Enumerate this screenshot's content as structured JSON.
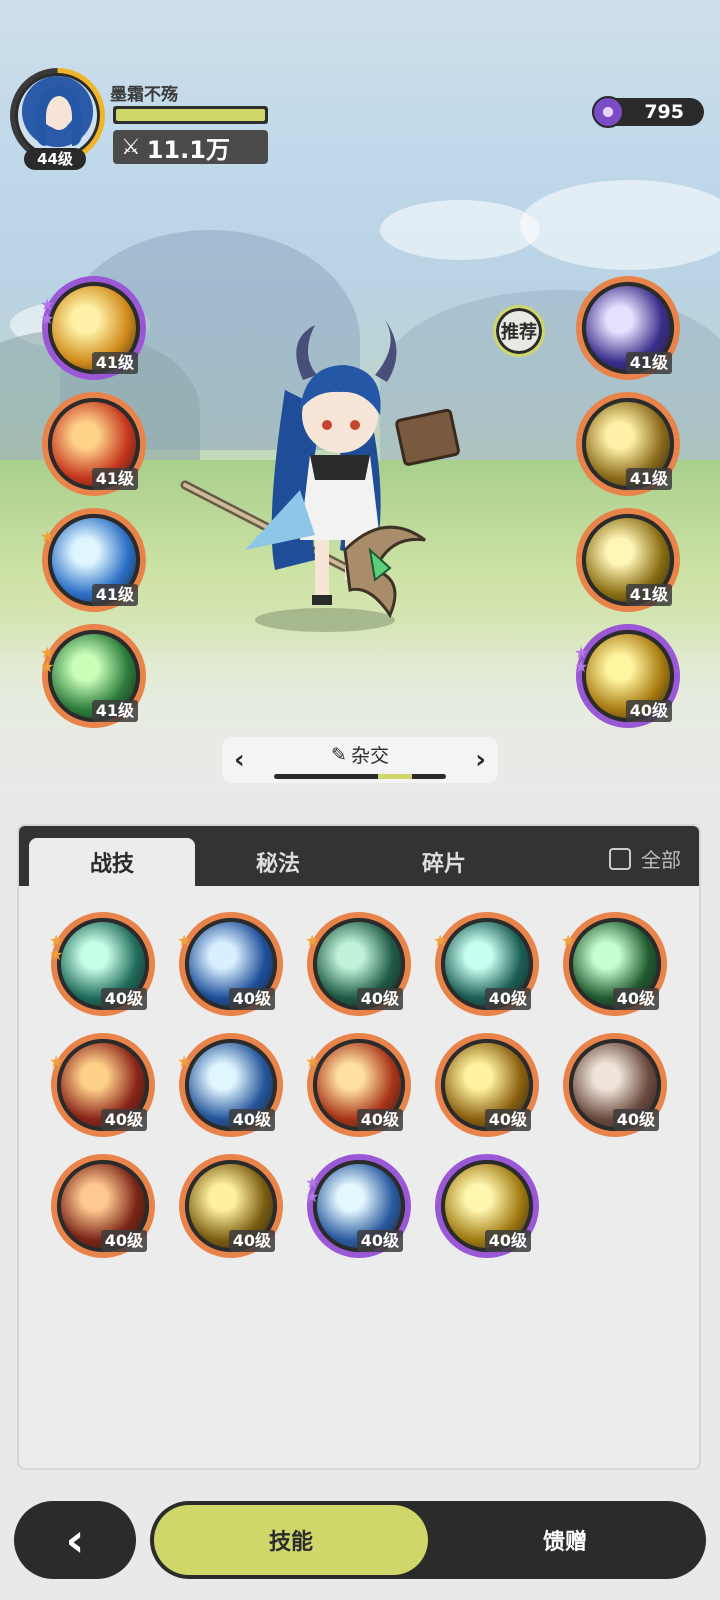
{
  "player": {
    "name": "墨霜不殇",
    "level": "44级",
    "power": "11.1万",
    "exp_fraction": 1.0
  },
  "currency": {
    "amount": "795",
    "icon": "purple-crystal-icon"
  },
  "recommend_label": "推荐",
  "left_skills": [
    {
      "level": "41级",
      "icon": "golden-lightning-icon",
      "frame": "purple",
      "stars": [
        "p",
        "p"
      ],
      "colors": [
        "#fff2a8",
        "#d08a1a"
      ]
    },
    {
      "level": "41级",
      "icon": "fire-burst-icon",
      "frame": "orange",
      "stars": [],
      "colors": [
        "#ffd28a",
        "#c4361d"
      ]
    },
    {
      "level": "41级",
      "icon": "ice-splash-icon",
      "frame": "orange",
      "stars": [
        "o"
      ],
      "colors": [
        "#dff6ff",
        "#2b6fc6"
      ]
    },
    {
      "level": "41级",
      "icon": "green-comet-icon",
      "frame": "orange",
      "stars": [
        "o",
        "o"
      ],
      "colors": [
        "#c9ffb8",
        "#2a7a3a"
      ]
    }
  ],
  "right_skills": [
    {
      "level": "41级",
      "icon": "starry-portal-icon",
      "frame": "orange",
      "stars": [],
      "colors": [
        "#e8e0ff",
        "#3a2f8a"
      ]
    },
    {
      "level": "41级",
      "icon": "golden-arrows-icon",
      "frame": "orange",
      "stars": [],
      "colors": [
        "#fff2a8",
        "#8a6a1a"
      ]
    },
    {
      "level": "41级",
      "icon": "golden-figure-icon",
      "frame": "orange",
      "stars": [],
      "colors": [
        "#fff6b8",
        "#8a6d12"
      ]
    },
    {
      "level": "40级",
      "icon": "golden-crack-icon",
      "frame": "purple",
      "stars": [
        "p",
        "p"
      ],
      "colors": [
        "#fff4a0",
        "#a87a10"
      ]
    }
  ],
  "style_selector": {
    "label": "杂交",
    "prev": "‹",
    "next": "›",
    "position": 0.75
  },
  "tabs": [
    {
      "label": "战技",
      "active": true
    },
    {
      "label": "秘法",
      "active": false
    },
    {
      "label": "碎片",
      "active": false
    }
  ],
  "show_all_label": "全部",
  "grid_skills": [
    {
      "level": "40级",
      "icon": "wind-slash-icon",
      "frame": "orange",
      "stars": [
        "o",
        "o"
      ],
      "colors": [
        "#c8ffe8",
        "#1f6a5a"
      ]
    },
    {
      "level": "40级",
      "icon": "water-wave-icon",
      "frame": "orange",
      "stars": [
        "o"
      ],
      "colors": [
        "#d8f0ff",
        "#1f4f9a"
      ]
    },
    {
      "level": "40级",
      "icon": "thorn-vine-icon",
      "frame": "orange",
      "stars": [
        "o"
      ],
      "colors": [
        "#bff2d8",
        "#1e5a45"
      ]
    },
    {
      "level": "40级",
      "icon": "whirlwind-icon",
      "frame": "orange",
      "stars": [
        "o"
      ],
      "colors": [
        "#c8fff0",
        "#1b5e55"
      ]
    },
    {
      "level": "40级",
      "icon": "green-heal-icon",
      "frame": "orange",
      "stars": [
        "o"
      ],
      "colors": [
        "#c8ffd0",
        "#1f5a2e"
      ]
    },
    {
      "level": "40级",
      "icon": "flame-icon",
      "frame": "orange",
      "stars": [
        "o"
      ],
      "colors": [
        "#ffd08a",
        "#8a2418"
      ]
    },
    {
      "level": "40级",
      "icon": "ice-crystal-icon",
      "frame": "orange",
      "stars": [
        "o"
      ],
      "colors": [
        "#e0f6ff",
        "#24559a"
      ]
    },
    {
      "level": "40级",
      "icon": "fireball-icon",
      "frame": "orange",
      "stars": [
        "o"
      ],
      "colors": [
        "#ffe0a0",
        "#a83418"
      ]
    },
    {
      "level": "40级",
      "icon": "golden-burst-icon",
      "frame": "orange",
      "stars": [],
      "colors": [
        "#fff2a0",
        "#8a6010"
      ]
    },
    {
      "level": "40级",
      "icon": "rock-shield-icon",
      "frame": "orange",
      "stars": [],
      "colors": [
        "#f0e4da",
        "#6a4a3e"
      ]
    },
    {
      "level": "40级",
      "icon": "fire-vortex-icon",
      "frame": "orange",
      "stars": [],
      "colors": [
        "#ffc890",
        "#7a2416"
      ]
    },
    {
      "level": "40级",
      "icon": "golden-pyramid-icon",
      "frame": "orange",
      "stars": [],
      "colors": [
        "#fff0a0",
        "#7a5c10"
      ]
    },
    {
      "level": "40级",
      "icon": "ice-spikes-icon",
      "frame": "purple",
      "stars": [
        "p",
        "p"
      ],
      "colors": [
        "#e4f8ff",
        "#2a5aa0"
      ]
    },
    {
      "level": "40级",
      "icon": "golden-orb-icon",
      "frame": "purple",
      "stars": [],
      "colors": [
        "#fff6b0",
        "#a07a10"
      ]
    }
  ],
  "bottom": {
    "back": "‹",
    "options": [
      {
        "label": "技能",
        "active": true
      },
      {
        "label": "馈赠",
        "active": false
      }
    ]
  }
}
